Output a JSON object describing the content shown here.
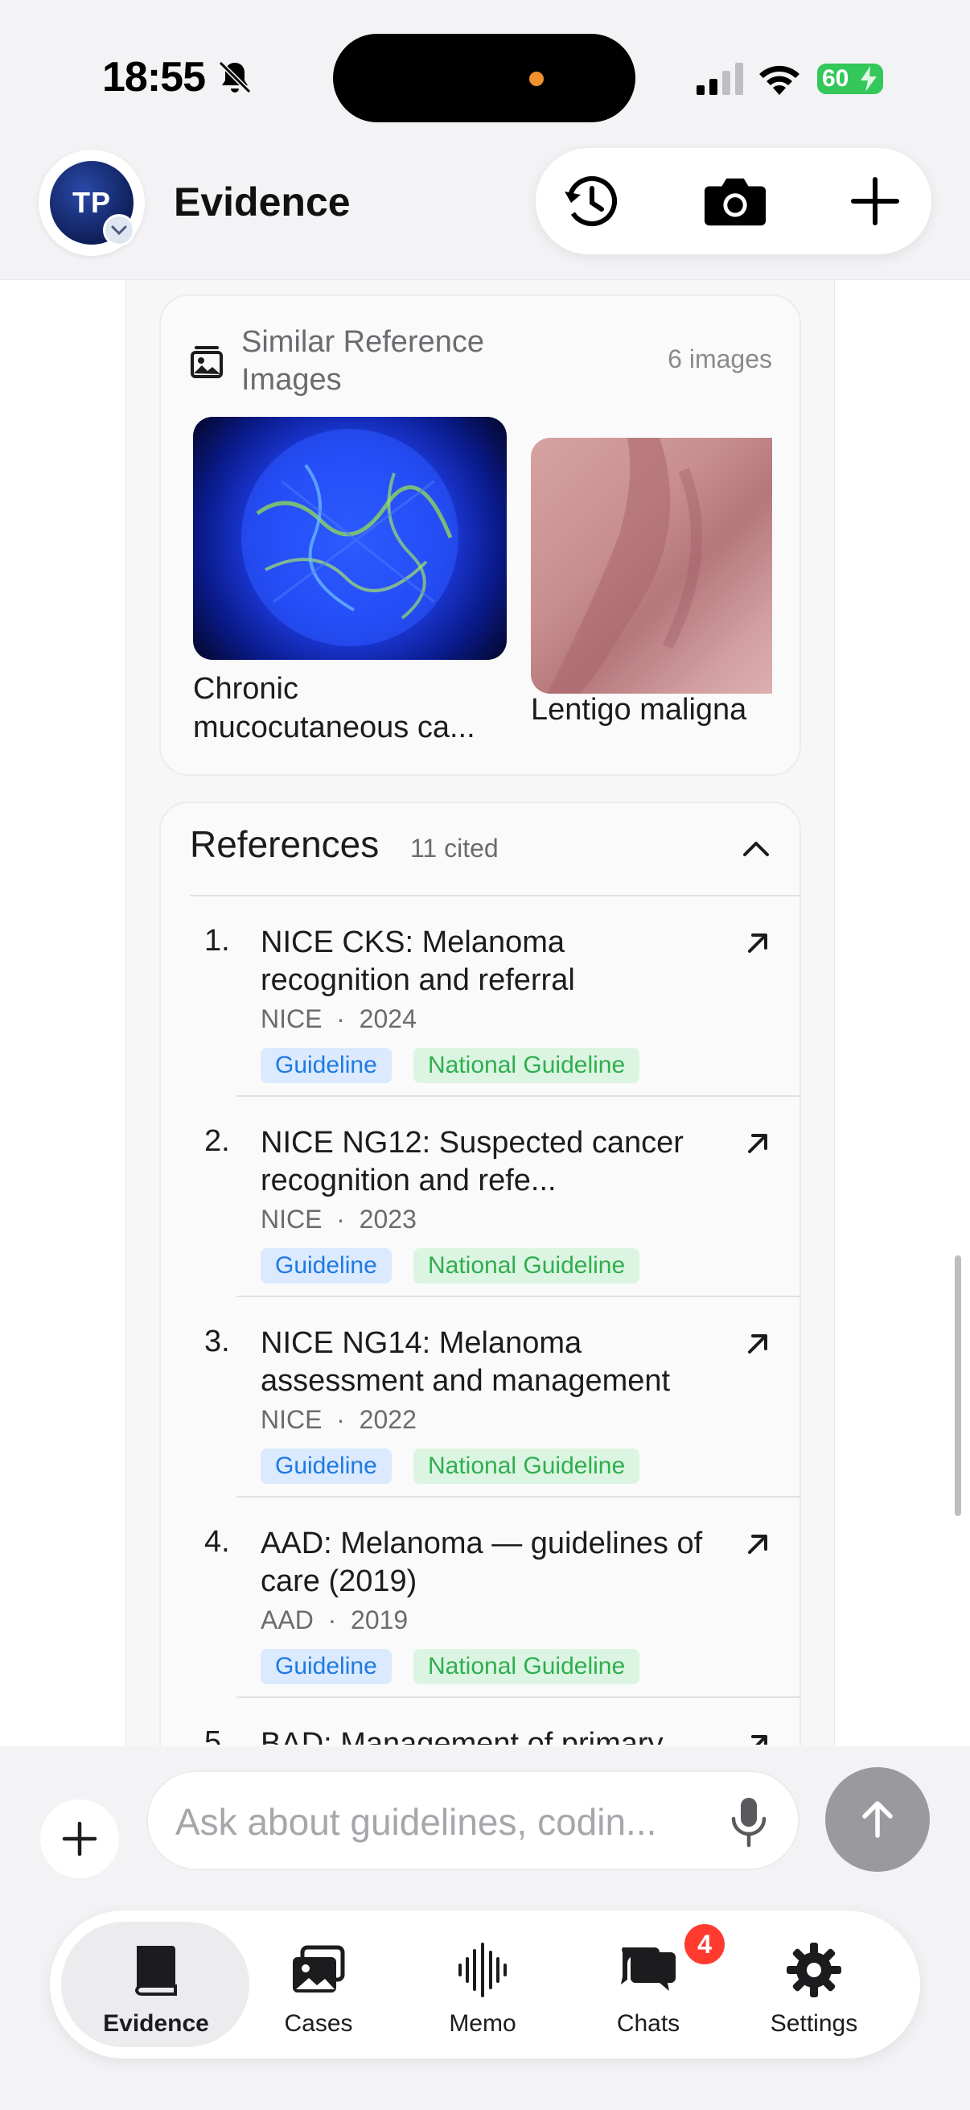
{
  "status_bar": {
    "time": "18:55",
    "battery": "60"
  },
  "header": {
    "avatar_initials": "TP",
    "title": "Evidence",
    "actions": [
      "history-icon",
      "camera-icon",
      "plus-icon"
    ]
  },
  "similar_images": {
    "title": "Similar Reference Images",
    "count": "6 images",
    "items": [
      {
        "caption": "Chronic mucocutaneous ca...",
        "color": "#1f3fe8"
      },
      {
        "caption": "Lentigo maligna",
        "color": "#c98f90"
      }
    ]
  },
  "references": {
    "title": "References",
    "cited": "11 cited",
    "items": [
      {
        "num": "1.",
        "title": "NICE CKS: Melanoma recognition and referral",
        "source": "NICE",
        "year": "2024",
        "tags": [
          "Guideline",
          "National Guideline"
        ]
      },
      {
        "num": "2.",
        "title": "NICE NG12: Suspected cancer recognition and refe...",
        "source": "NICE",
        "year": "2023",
        "tags": [
          "Guideline",
          "National Guideline"
        ]
      },
      {
        "num": "3.",
        "title": "NICE NG14: Melanoma assessment and management",
        "source": "NICE",
        "year": "2022",
        "tags": [
          "Guideline",
          "National Guideline"
        ]
      },
      {
        "num": "4.",
        "title": "AAD: Melanoma — guidelines of care (2019)",
        "source": "AAD",
        "year": "2019",
        "tags": [
          "Guideline",
          "National Guideline"
        ]
      },
      {
        "num": "5.",
        "title": "BAD: Management of primary",
        "source": "",
        "year": "",
        "tags": []
      }
    ]
  },
  "composer": {
    "placeholder": "Ask about guidelines, codin..."
  },
  "tabs": [
    {
      "label": "Evidence",
      "icon": "book-icon",
      "active": true
    },
    {
      "label": "Cases",
      "icon": "images-icon"
    },
    {
      "label": "Memo",
      "icon": "waveform-icon"
    },
    {
      "label": "Chats",
      "icon": "chat-bubbles-icon",
      "badge": "4"
    },
    {
      "label": "Settings",
      "icon": "gear-icon"
    }
  ],
  "colors": {
    "accent_blue": "#1f7ae0",
    "tag_green": "#2fae4e",
    "badge_red": "#ff3b30",
    "battery_green": "#34c759"
  }
}
